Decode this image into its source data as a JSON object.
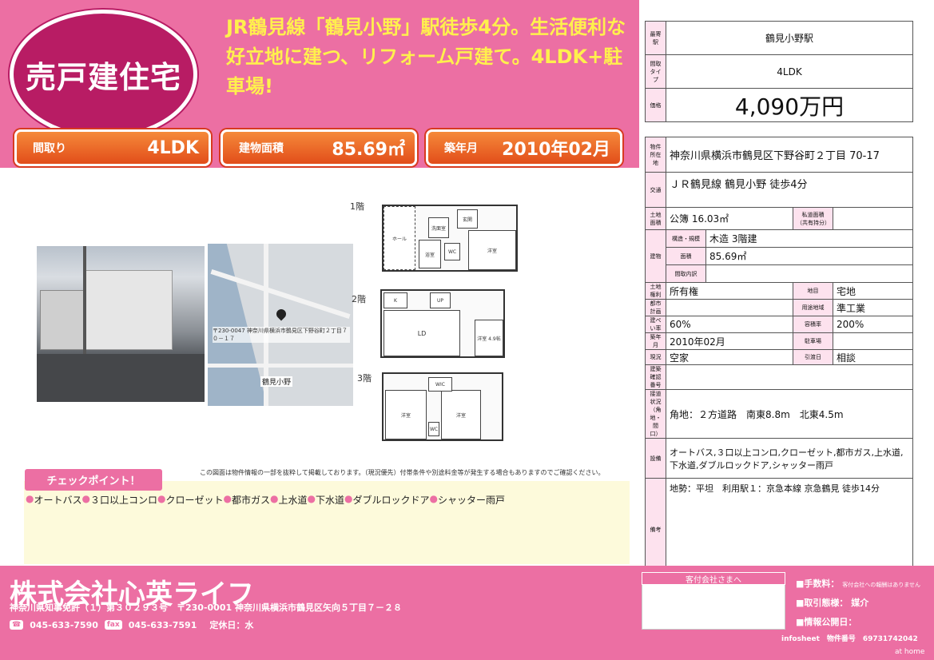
{
  "header": {
    "type_badge": "売戸建住宅",
    "catchphrase": "JR鶴見線「鶴見小野」駅徒歩4分。生活便利な好立地に建つ、リフォーム戸建て。4LDK+駐車場!"
  },
  "specs": [
    {
      "label": "間取り",
      "value": "4LDK"
    },
    {
      "label": "建物面積",
      "value": "85.69㎡"
    },
    {
      "label": "築年月",
      "value": "2010年02月"
    }
  ],
  "map": {
    "address_caption": "〒230-0047 神奈川県横浜市鶴見区下野谷町２丁目７０－１７",
    "station_label": "鶴見小野"
  },
  "floors": {
    "f1": "1階",
    "f2": "2階",
    "f3": "3階",
    "rooms_f1": [
      "洋室",
      "浴室",
      "洗面室",
      "WC",
      "玄関",
      "ホール"
    ],
    "rooms_f2": [
      "LD",
      "洋室 4.9帖",
      "K",
      "UP"
    ],
    "rooms_f3": [
      "洋室",
      "洋室",
      "WIC",
      "WC"
    ],
    "disclaimer": "この図面は物件情報の一部を抜粋して掲載しております。（現況優先）付帯条件や別途料金等が発生する場合もありますのでご確認ください。"
  },
  "checkpoints": {
    "title": "チェックポイント！",
    "items": [
      "オートバス",
      "３口以上コンロ",
      "クローゼット",
      "都市ガス",
      "上水道",
      "下水道",
      "ダブルロックドア",
      "シャッター雨戸"
    ]
  },
  "summary": {
    "station_key": "最寄駅",
    "station": "鶴見小野駅",
    "layout_key": "間取タイプ",
    "layout": "4LDK",
    "price_key": "価格",
    "price": "4,090万円"
  },
  "details": {
    "address_key": "物件所在地",
    "address": "神奈川県横浜市鶴見区下野谷町２丁目 70-17",
    "transport_key": "交通",
    "transport": "ＪＲ鶴見線 鶴見小野 徒歩4分",
    "land_area_key": "土地面積",
    "land_area": "公簿 16.03㎡",
    "private_road_key": "私道面積（共有持分）",
    "building_key": "建物",
    "structure_key": "構造・規模",
    "structure": "木造 3階建",
    "area_key": "面積",
    "area": "85.69㎡",
    "floor_plan_key": "間取内訳",
    "land_right_key": "土地権利",
    "land_right": "所有権",
    "land_category_key": "地目",
    "land_category": "宅地",
    "city_plan_key": "都市計画",
    "zoning_key": "用途地域",
    "zoning": "準工業",
    "bcr_key": "建ぺい率",
    "bcr": "60%",
    "far_key": "容積率",
    "far": "200%",
    "built_key": "築年月",
    "built": "2010年02月",
    "parking_key": "駐車場",
    "status_key": "現況",
    "status": "空家",
    "handover_key": "引渡日",
    "handover": "相談",
    "confirm_key": "建築確認番号",
    "road_key": "接道状況（角地・間口）",
    "road": "角地：２方道路　南東8.8m　北東4.5m",
    "equipment_key": "設備",
    "equipment": "オートバス,３口以上コンロ,クローゼット,都市ガス,上水道,下水道,ダブルロックドア,シャッター雨戸",
    "remarks_key": "備考",
    "remarks": "地勢：平坦　利用駅１：京急本線 京急鶴見 徒歩14分"
  },
  "footer": {
    "company": "株式会社心英ライフ",
    "license": "神奈川県知事免許（１）第３０２９３号　〒230-0001 神奈川県横浜市鶴見区矢向５丁目７－２８",
    "tel_label": "☎",
    "tel": "045-633-7590",
    "fax_label": "fax",
    "fax": "045-633-7591",
    "holiday": "定休日：水",
    "broker_head": "客付会社さまへ",
    "fee_label": "■手数料：",
    "fee_note": "客付会社への報酬はありません",
    "deal_label": "■取引態様：",
    "deal": "媒介",
    "publish_label": "■情報公開日：",
    "infosheet": "infosheet　物件番号　69731742042",
    "brand": "at home"
  },
  "colors": {
    "pink": "#ec6fa3",
    "badge": "#b81c64",
    "orange": "#e24d1a",
    "yellow": "#fff04d"
  }
}
